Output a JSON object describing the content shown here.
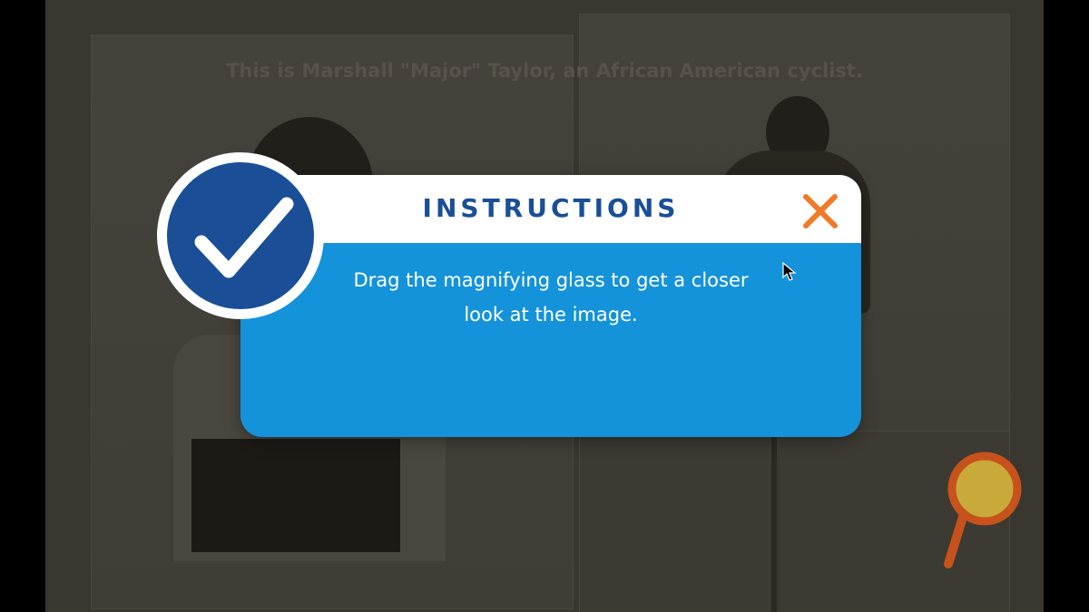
{
  "background": {
    "caption": "This is Marshall \"Major\" Taylor, an African American cyclist."
  },
  "magnifier": {
    "icon": "magnifying-glass-icon",
    "ring_color": "#c7521c",
    "lens_color": "#c9a93a"
  },
  "dialog": {
    "title": "INSTRUCTIONS",
    "body_line1": "Drag the magnifying glass to get a closer",
    "body_line2": "look at the image.",
    "close_icon": "close-icon",
    "badge_icon": "checkmark-icon",
    "colors": {
      "header_bg": "#ffffff",
      "body_bg": "#1493da",
      "title": "#1a4f97",
      "close": "#f07a2a",
      "badge": "#1a4f97"
    }
  }
}
